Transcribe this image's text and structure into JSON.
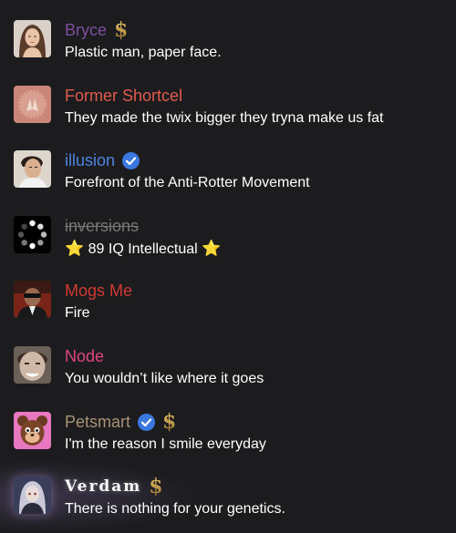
{
  "users": [
    {
      "name": "Bryce",
      "name_color": "#7d4e9e",
      "bio": "Plastic man, paper face.",
      "verified": false,
      "premium": true,
      "avatar": "avatar-young-woman-portrait"
    },
    {
      "name": "Former Shortcel",
      "name_color": "#e15a4d",
      "bio": "They made the twix bigger they tryna make us fat",
      "verified": false,
      "premium": false,
      "avatar": "avatar-pink-praying-hands"
    },
    {
      "name": "illusion",
      "name_color": "#4f83e0",
      "bio": "Forefront of the Anti-Rotter Movement",
      "verified": true,
      "premium": false,
      "avatar": "avatar-man-portrait"
    },
    {
      "name": "inversions",
      "name_color": "#777777",
      "bio_prefix": "⭐",
      "bio": "89 IQ Intellectual",
      "bio_suffix": "⭐",
      "verified": false,
      "premium": false,
      "strikethrough": true,
      "avatar": "avatar-loading-spinner"
    },
    {
      "name": "Mogs Me",
      "name_color": "#d23a33",
      "bio": "Fire",
      "verified": false,
      "premium": false,
      "avatar": "avatar-man-sunglasses-suit"
    },
    {
      "name": "Node",
      "name_color": "#e0467d",
      "bio": "You wouldn’t like where it goes",
      "verified": false,
      "premium": false,
      "avatar": "avatar-man-smiling-closeup"
    },
    {
      "name": "Petsmart",
      "name_color": "#a89276",
      "bio": "I'm the reason I smile everyday",
      "verified": true,
      "premium": true,
      "avatar": "avatar-cartoon-bear"
    },
    {
      "name": "Verdam",
      "name_color": "#ffffff",
      "bio": "There is nothing for your genetics.",
      "verified": false,
      "premium": true,
      "avatar": "avatar-anime-character"
    }
  ],
  "badges": {
    "verified_icon": "verified-check-icon",
    "premium_icon": "dollar-sign-icon",
    "premium_symbol": "$",
    "verified_color": "#3a78e0",
    "premium_color": "#b8933e"
  }
}
